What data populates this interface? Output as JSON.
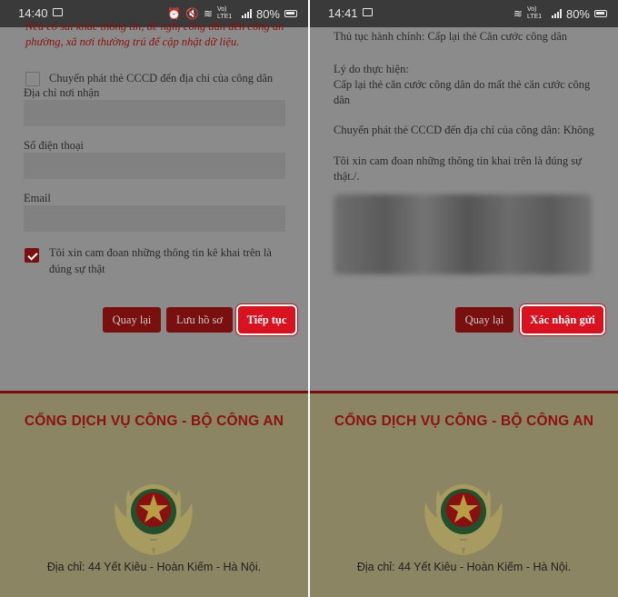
{
  "left": {
    "status": {
      "time": "14:40",
      "battery": "80%",
      "volte": "Vo) LTE1"
    },
    "warning_text": "Nếu có sai khác thông tin, đề nghị công dân đến công an phường, xã nơi thường trú để cập nhật dữ liệu.",
    "delivery_checkbox_label": "Chuyển phát thẻ CCCD đến địa chỉ của công dân",
    "address_label": "Địa chỉ nơi nhận",
    "phone_label": "Số điện thoại",
    "email_label": "Email",
    "commit_label": "Tôi xin cam đoan những thông tin kê khai trên là đúng sự thật",
    "btn_back": "Quay lại",
    "btn_save": "Lưu hồ sơ",
    "btn_next": "Tiếp tục"
  },
  "right": {
    "status": {
      "time": "14:41",
      "battery": "80%",
      "volte": "Vo) LTE1"
    },
    "procedure_line": "Thủ tục hành chính: Cấp lại thẻ Căn cước công dân",
    "reason_title": "Lý do thực hiện:",
    "reason_text": "Cấp lại thẻ căn cước công dân do mất thẻ căn cước công dân",
    "delivery_line": "Chuyển phát thẻ CCCD đến địa chỉ của công dân: Không",
    "commit_line": "Tôi xin cam đoan những thông tin khai trên là đúng sự thật./.",
    "btn_back": "Quay lại",
    "btn_submit": "Xác nhận gửi"
  },
  "footer": {
    "title": "CỔNG DỊCH VỤ CÔNG - BỘ CÔNG AN",
    "address": "Địa chỉ: 44 Yết Kiêu - Hoàn Kiếm - Hà Nội."
  },
  "colors": {
    "primary_red": "#d8121e",
    "dark_red": "#7a0f0f",
    "footer_bg": "#8c8563",
    "overlay_gray": "#8b8b8b"
  },
  "icons": [
    "image-icon",
    "alarm-icon",
    "mute-icon",
    "wifi-icon",
    "signal-icon",
    "battery-icon",
    "police-emblem-icon"
  ]
}
